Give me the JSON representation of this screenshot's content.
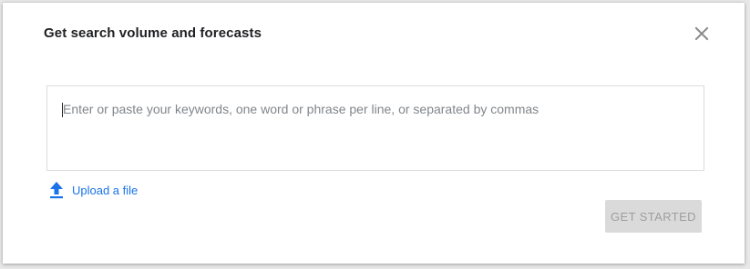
{
  "dialog": {
    "title": "Get search volume and forecasts",
    "close_icon": "close-icon"
  },
  "keywords": {
    "placeholder": "Enter or paste your keywords, one word or phrase per line, or separated by commas",
    "value": ""
  },
  "upload": {
    "icon": "upload-icon",
    "label": "Upload a file"
  },
  "actions": {
    "get_started_label": "GET STARTED",
    "get_started_state": "disabled"
  },
  "colors": {
    "accent": "#1a73e8",
    "disabled_bg": "#dadada",
    "disabled_text": "#9e9e9e"
  }
}
